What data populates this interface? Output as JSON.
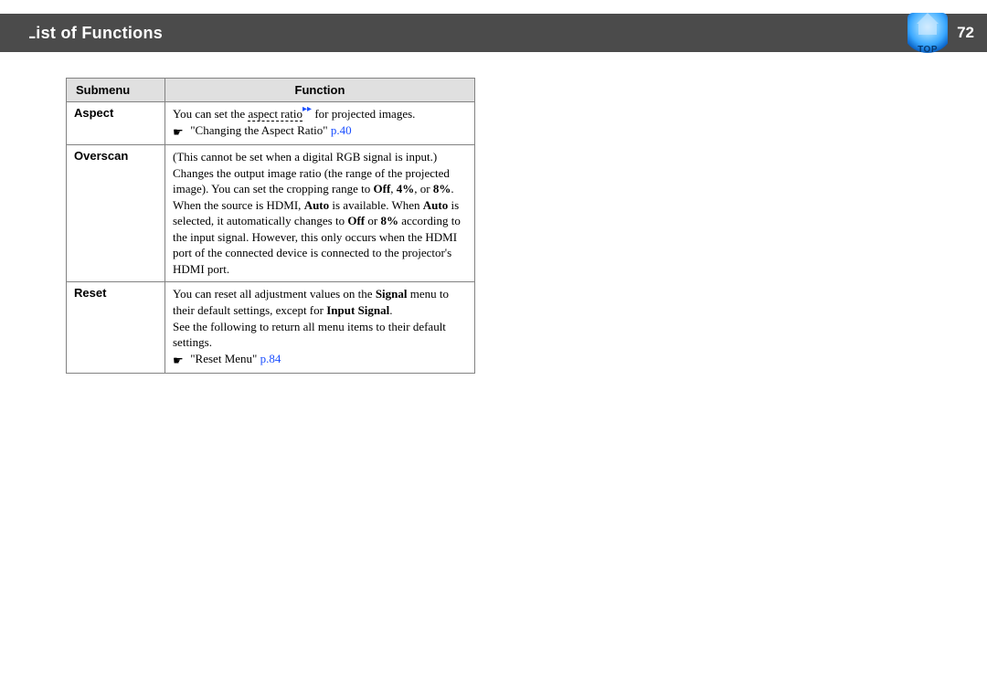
{
  "header": {
    "title": "List of Functions",
    "top_icon_label": "TOP",
    "page_number": "72"
  },
  "table": {
    "col_submenu": "Submenu",
    "col_function": "Function"
  },
  "rows": {
    "aspect": {
      "name": "Aspect",
      "line1_pre": "You can set the ",
      "line1_link": "aspect ratio",
      "line1_post": " for projected images.",
      "ref_title": "\"Changing the Aspect Ratio\" ",
      "ref_page": "p.40"
    },
    "overscan": {
      "name": "Overscan",
      "note": "(This cannot be set when a digital RGB signal is input.)",
      "t1": "Changes the output image ratio (the range of the projected image). You can set the cropping range to ",
      "b1": "Off",
      "sep1": ", ",
      "b2": "4%",
      "sep2": ", or ",
      "b3": "8%",
      "t2": ". When the source is HDMI, ",
      "b4": "Auto",
      "t3": " is available. When ",
      "b5": "Auto",
      "t4": " is selected, it automatically changes to ",
      "b6": "Off",
      "t5": " or ",
      "b7": "8%",
      "t6": " according to the input signal. However, this only occurs when the HDMI port of the connected device is connected to the projector's HDMI port."
    },
    "reset": {
      "name": "Reset",
      "t1": "You can reset all adjustment values on the ",
      "b1": "Signal",
      "t2": " menu to their default settings, except for ",
      "b2": "Input Signal",
      "t3": ".",
      "t4": "See the following to return all menu items to their default settings.",
      "ref_title": "\"Reset Menu\" ",
      "ref_page": "p.84"
    }
  }
}
